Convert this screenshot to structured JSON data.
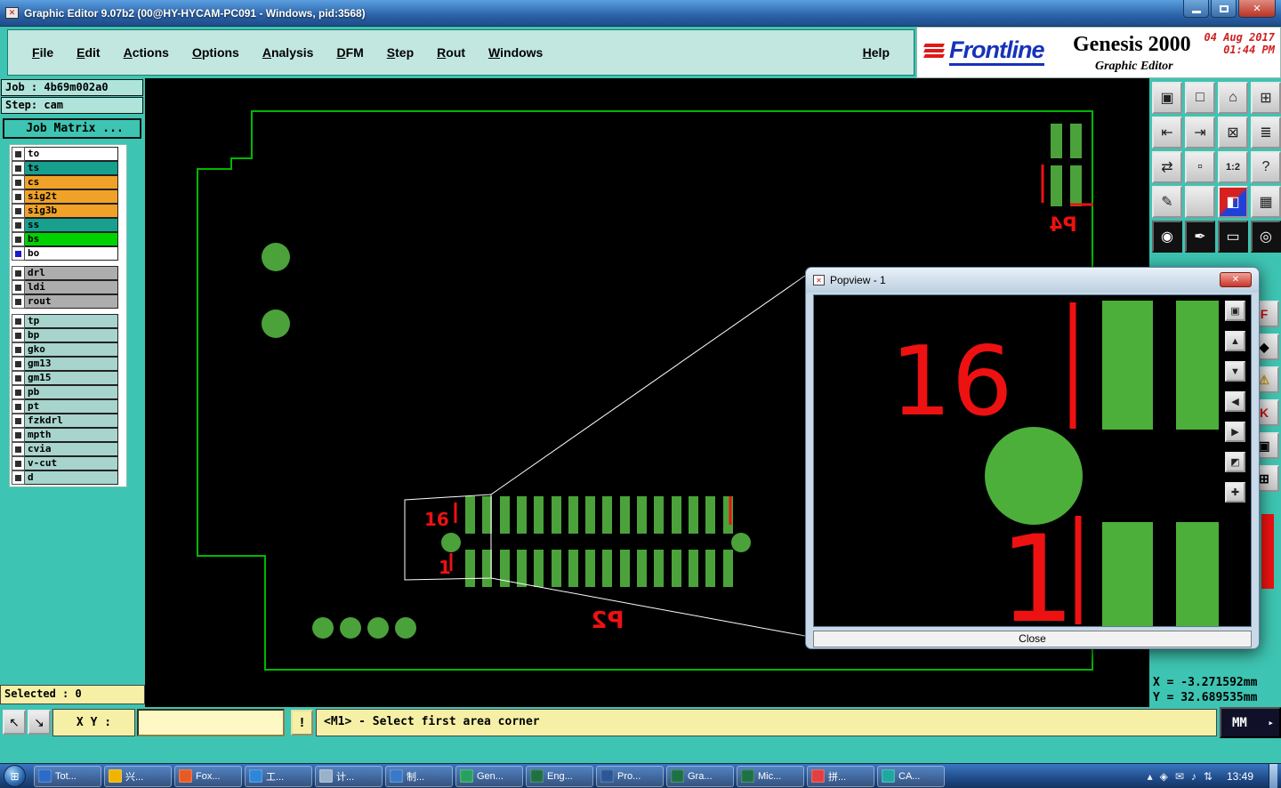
{
  "window": {
    "title": "Graphic Editor 9.07b2 (00@HY-HYCAM-PC091 - Windows, pid:3568)"
  },
  "menu": {
    "items": [
      "File",
      "Edit",
      "Actions",
      "Options",
      "Analysis",
      "DFM",
      "Step",
      "Rout",
      "Windows"
    ],
    "help": "Help"
  },
  "brand": {
    "logo": "Frontline",
    "product": "Genesis 2000",
    "date": "04 Aug 2017",
    "time": "01:44 PM",
    "subtitle": "Graphic Editor"
  },
  "sidebar": {
    "job": "Job : 4b69m002a0",
    "step": "Step: cam",
    "job_matrix": "Job Matrix ...",
    "selected": "Selected : 0",
    "layers": [
      {
        "name": "to",
        "color": "#FFFFFF",
        "check": "#2E2E2E"
      },
      {
        "name": "ts",
        "color": "#18A08E",
        "check": "#2E2E2E"
      },
      {
        "name": "cs",
        "color": "#F0A228",
        "check": "#2E2E2E"
      },
      {
        "name": "sig2t",
        "color": "#F0A228",
        "check": "#2E2E2E"
      },
      {
        "name": "sig3b",
        "color": "#F0A228",
        "check": "#2E2E2E"
      },
      {
        "name": "ss",
        "color": "#18A08E",
        "check": "#2E2E2E"
      },
      {
        "name": "bs",
        "color": "#00D200",
        "check": "#2E2E2E"
      },
      {
        "name": "bo",
        "color": "#FFFFFF",
        "check": "#1A1AC8"
      },
      {
        "name": "drl",
        "color": "#ADADAD",
        "check": "#2E2E2E"
      },
      {
        "name": "ldi",
        "color": "#ADADAD",
        "check": "#2E2E2E"
      },
      {
        "name": "rout",
        "color": "#ADADAD",
        "check": "#2E2E2E"
      },
      {
        "name": "tp",
        "color": "#A7D4CC",
        "check": "#2E2E2E"
      },
      {
        "name": "bp",
        "color": "#A7D4CC",
        "check": "#2E2E2E"
      },
      {
        "name": "gko",
        "color": "#A7D4CC",
        "check": "#2E2E2E"
      },
      {
        "name": "gm13",
        "color": "#A7D4CC",
        "check": "#2E2E2E"
      },
      {
        "name": "gm15",
        "color": "#A7D4CC",
        "check": "#2E2E2E"
      },
      {
        "name": "pb",
        "color": "#A7D4CC",
        "check": "#2E2E2E"
      },
      {
        "name": "pt",
        "color": "#A7D4CC",
        "check": "#2E2E2E"
      },
      {
        "name": "fzkdrl",
        "color": "#A7D4CC",
        "check": "#2E2E2E"
      },
      {
        "name": "mpth",
        "color": "#A7D4CC",
        "check": "#2E2E2E"
      },
      {
        "name": "cvia",
        "color": "#A7D4CC",
        "check": "#2E2E2E"
      },
      {
        "name": "v-cut",
        "color": "#A7D4CC",
        "check": "#2E2E2E"
      },
      {
        "name": "d",
        "color": "#A7D4CC",
        "check": "#2E2E2E"
      }
    ]
  },
  "canvas_labels": {
    "pin16": "16",
    "pin1": "1",
    "ref_p2": "P2",
    "ref_p4": "P4"
  },
  "popview": {
    "title": "Popview - 1",
    "pin16": "16",
    "pin1": "1",
    "close_button": "Close",
    "tools": [
      {
        "name": "popview-window",
        "glyph": "▣"
      },
      {
        "name": "popview-pan-up",
        "glyph": "▲"
      },
      {
        "name": "popview-pan-down",
        "glyph": "▼"
      },
      {
        "name": "popview-pan-left",
        "glyph": "◀"
      },
      {
        "name": "popview-pan-right",
        "glyph": "▶"
      },
      {
        "name": "popview-resize",
        "glyph": "◩"
      },
      {
        "name": "popview-center",
        "glyph": "✚"
      }
    ]
  },
  "right_toolbar": {
    "buttons": [
      {
        "name": "view-panel",
        "glyph": "▣"
      },
      {
        "name": "display-window",
        "glyph": "□"
      },
      {
        "name": "home-view",
        "glyph": "⌂"
      },
      {
        "name": "grid-toggle",
        "glyph": "⊞"
      },
      {
        "name": "pan-left",
        "glyph": "⇤"
      },
      {
        "name": "pan-right",
        "glyph": "⇥"
      },
      {
        "name": "zoom-area",
        "glyph": "⊠"
      },
      {
        "name": "layer-list",
        "glyph": "≣"
      },
      {
        "name": "swap-view",
        "glyph": "⇄"
      },
      {
        "name": "highlight-box",
        "glyph": "▫"
      },
      {
        "name": "zoom-ratio",
        "glyph": "1:2"
      },
      {
        "name": "help-tool",
        "glyph": "?"
      },
      {
        "name": "draw-tool",
        "glyph": "✎"
      },
      {
        "name": "blank-tool",
        "glyph": ""
      },
      {
        "name": "color-layers",
        "glyph": "◧"
      },
      {
        "name": "hatch-tool",
        "glyph": "▦"
      },
      {
        "name": "dot-tool",
        "glyph": "◉"
      },
      {
        "name": "pen-tool",
        "glyph": "✒"
      },
      {
        "name": "ruler-tool",
        "glyph": "▭"
      },
      {
        "name": "target-tool",
        "glyph": "◎"
      }
    ],
    "side_buttons": [
      {
        "name": "flag-f-tool",
        "glyph": "F"
      },
      {
        "name": "diamond-tool",
        "glyph": "◆"
      },
      {
        "name": "warning-tool",
        "glyph": "⚠"
      },
      {
        "name": "key-k-tool",
        "glyph": "K"
      },
      {
        "name": "panel-tool",
        "glyph": "▣"
      },
      {
        "name": "expand-tool",
        "glyph": "⊞"
      }
    ]
  },
  "statusbar": {
    "xy_label": "X Y :",
    "xy_value": "",
    "alert": "!",
    "prompt": "<M1> - Select first area corner",
    "coord_x": "X = -3.271592mm",
    "coord_y": "Y = 32.689535mm",
    "units": "MM"
  },
  "taskbar": {
    "items": [
      {
        "label": "Tot...",
        "color": "#2C6BC8"
      },
      {
        "label": "兴...",
        "color": "#F0B400"
      },
      {
        "label": "Fox...",
        "color": "#E85A24"
      },
      {
        "label": "工...",
        "color": "#2E86D8"
      },
      {
        "label": "计...",
        "color": "#9AB2C8"
      },
      {
        "label": "制...",
        "color": "#3A78C8"
      },
      {
        "label": "Gen...",
        "color": "#28A060"
      },
      {
        "label": "Eng...",
        "color": "#1E7145"
      },
      {
        "label": "Pro...",
        "color": "#2B5797"
      },
      {
        "label": "Gra...",
        "color": "#1E7145"
      },
      {
        "label": "Mic...",
        "color": "#1E7145"
      },
      {
        "label": "拼...",
        "color": "#E04040"
      },
      {
        "label": "CA...",
        "color": "#20A8A0"
      }
    ],
    "tray": [
      {
        "name": "hidden-icons",
        "glyph": "▴"
      },
      {
        "name": "tray-app",
        "glyph": "◈"
      },
      {
        "name": "tray-mail",
        "glyph": "✉"
      },
      {
        "name": "tray-volume",
        "glyph": "♪"
      },
      {
        "name": "tray-network",
        "glyph": "⇅"
      }
    ],
    "clock": "13:49"
  },
  "colors": {
    "teal": "#3EC4B2",
    "teal_light": "#C2E7E0",
    "label_bg": "#AFE4DB",
    "yellow": "#F6F0A6",
    "input_yellow": "#FDF8C4",
    "pad": "#4BA23A",
    "outline": "#00B800",
    "red": "#EE1111",
    "dark_navy": "#101028"
  }
}
